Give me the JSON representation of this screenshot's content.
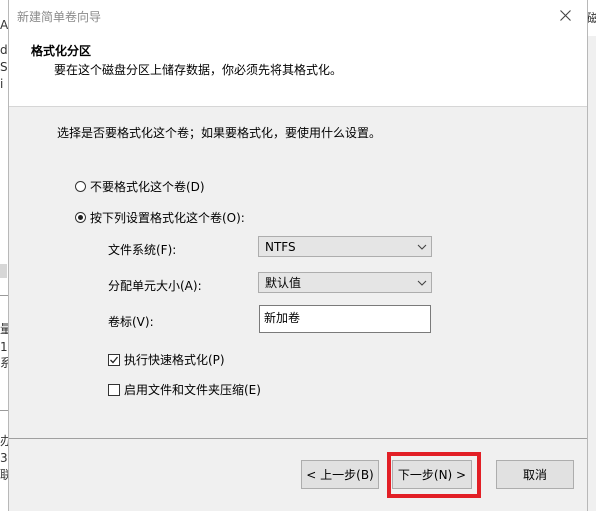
{
  "background_window": {
    "left_chars": [
      "A",
      "d",
      "S",
      "i",
      "量",
      "系",
      "办",
      "3",
      "联",
      "1",
      "3",
      "属"
    ],
    "right_char": "磁"
  },
  "dialog": {
    "title": "新建简单卷向导",
    "close_icon": "close-icon",
    "header": {
      "title": "格式化分区",
      "subtitle": "要在这个磁盘分区上储存数据，你必须先将其格式化。"
    },
    "prompt": "选择是否要格式化这个卷；如果要格式化，要使用什么设置。",
    "options": {
      "no_format": {
        "label": "不要格式化这个卷(D)",
        "selected": false
      },
      "format": {
        "label": "按下列设置格式化这个卷(O):",
        "selected": true
      }
    },
    "fields": {
      "filesystem": {
        "label": "文件系统(F):",
        "value": "NTFS"
      },
      "allocation": {
        "label": "分配单元大小(A):",
        "value": "默认值"
      },
      "volume_label": {
        "label": "卷标(V):",
        "value": "新加卷"
      }
    },
    "checkboxes": {
      "quick_format": {
        "label": "执行快速格式化(P)",
        "checked": true
      },
      "compression": {
        "label": "启用文件和文件夹压缩(E)",
        "checked": false
      }
    },
    "buttons": {
      "back": "< 上一步(B)",
      "next": "下一步(N) >",
      "cancel": "取消"
    },
    "highlight_color": "#e21f26"
  }
}
